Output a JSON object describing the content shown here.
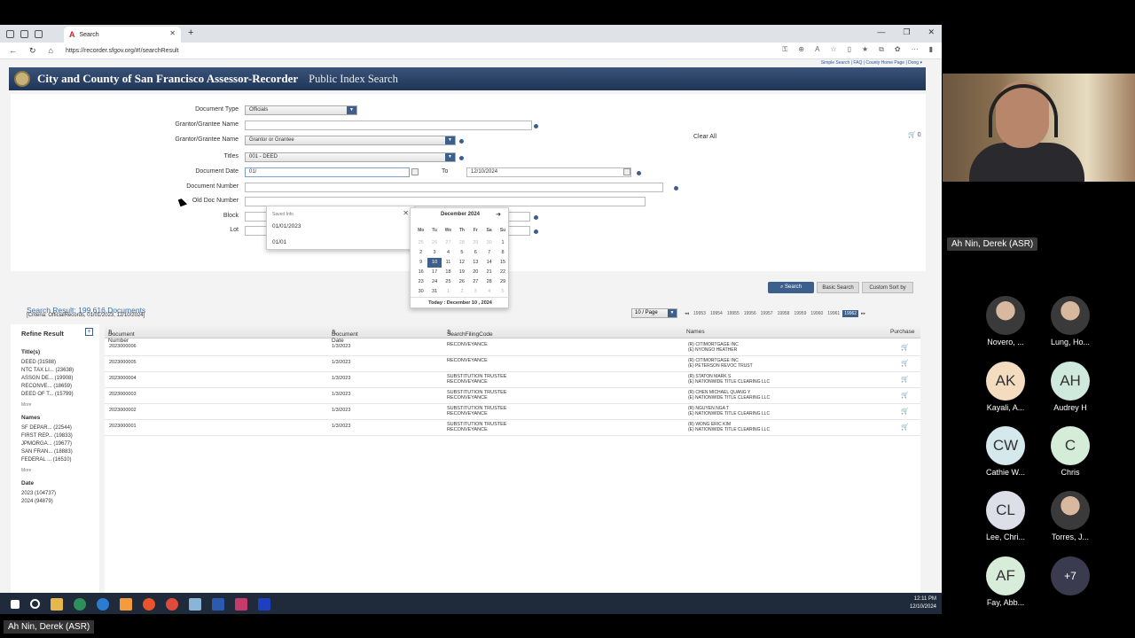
{
  "browser": {
    "tab_title": "Search",
    "url": "https://recorder.sfgov.org/#!/searchResult",
    "top_links": "Simple Search | FAQ | County Home Page | Dong ▾"
  },
  "banner": {
    "org": "City and County of San Francisco Assessor-Recorder",
    "subtitle": "Public Index Search"
  },
  "form": {
    "document_type_label": "Document Type",
    "document_type_value": "Officials",
    "grantor_name_label": "Grantor/Grantee Name",
    "grantor_name_value": "",
    "grantor_type_label": "Grantor/Grantee Name",
    "grantor_type_value": "Grantor or Grantee",
    "titles_label": "Titles",
    "titles_value": "001 - DEED",
    "doc_date_label": "Document Date",
    "doc_date_from": "01/",
    "to_label": "To",
    "doc_date_to": "12/10/2024",
    "doc_number_label": "Document Number",
    "old_doc_label": "Old Doc Number",
    "block_label": "Block",
    "lot_label": "Lot",
    "clear_all": "Clear All",
    "cart_count": "0"
  },
  "saved_info": {
    "header": "Saved Info",
    "items": [
      "01/01/2023",
      "01/01"
    ]
  },
  "calendar": {
    "month": "December 2024",
    "days_of_week": [
      "Mo",
      "Tu",
      "We",
      "Th",
      "Fr",
      "Sa",
      "Su"
    ],
    "today_text": "Today : December 10 , 2024"
  },
  "buttons": {
    "search": "Search",
    "basic_search": "Basic Search",
    "custom_sort": "Custom Sort by"
  },
  "results": {
    "title": "Search Result: 199,616 Documents",
    "criteria": "[Criteria: OfficialRecords, 01/01/2023, 12/10/2024]",
    "per_page": "10 / Page",
    "pages": [
      "19953",
      "19954",
      "19955",
      "19956",
      "19957",
      "19958",
      "19959",
      "19960",
      "19961",
      "19962"
    ],
    "columns": [
      "Document Number",
      "Document Date",
      "SearchFilingCode",
      "Names",
      "Purchase"
    ],
    "rows": [
      {
        "num": "2023000006",
        "date": "1/3/2023",
        "code": "RECONVEYANCE",
        "code2": "",
        "name1": "(R) CITIMORTGAGE INC",
        "name2": "(E) NYONGO HEATHER"
      },
      {
        "num": "2023000005",
        "date": "1/3/2023",
        "code": "RECONVEYANCE",
        "code2": "",
        "name1": "(R) CITIMORTGAGE INC",
        "name2": "(E) PETERSON REVOC TRUST"
      },
      {
        "num": "2023000004",
        "date": "1/3/2023",
        "code": "SUBSTITUTION TRUSTEE",
        "code2": "RECONVEYANCE",
        "name1": "(R) STATON MARK S",
        "name2": "(E) NATIONWIDE TITLE CLEARING LLC"
      },
      {
        "num": "2023000003",
        "date": "1/3/2023",
        "code": "SUBSTITUTION TRUSTEE",
        "code2": "RECONVEYANCE",
        "name1": "(R) CHEN MICHAEL QUANG Y",
        "name2": "(E) NATIONWIDE TITLE CLEARING LLC"
      },
      {
        "num": "2023000002",
        "date": "1/3/2023",
        "code": "SUBSTITUTION TRUSTEE",
        "code2": "RECONVEYANCE",
        "name1": "(R) NGUYEN NGA T",
        "name2": "(E) NATIONWIDE TITLE CLEARING LLC"
      },
      {
        "num": "2023000001",
        "date": "1/3/2023",
        "code": "SUBSTITUTION TRUSTEE",
        "code2": "RECONVEYANCE",
        "name1": "(R) WONG ERIC KIM",
        "name2": "(E) NATIONWIDE TITLE CLEARING LLC"
      }
    ]
  },
  "refine": {
    "title": "Refine Result",
    "titles_header": "Title(s)",
    "titles": [
      "DEED (31588)",
      "NTC TAX LI... (23638)",
      "ASSGN DE... (19908)",
      "RECONVE... (18659)",
      "DEED OF T... (15799)"
    ],
    "names_header": "Names",
    "names": [
      "SF DEPAR... (22544)",
      "FIRST REP... (19833)",
      "JPMORGA... (19677)",
      "SAN FRAN... (18883)",
      "FEDERAL ... (16510)"
    ],
    "date_header": "Date",
    "dates": [
      "2023 (104737)",
      "2024 (94879)"
    ],
    "more": "More"
  },
  "taskbar": {
    "time": "12:11 PM",
    "date": "12/10/2024"
  },
  "meeting": {
    "speaker_tag": "Ah Nin, Derek (ASR)",
    "bottom_tag": "Ah Nin, Derek (ASR)",
    "participants": [
      {
        "name": "Novero, ...",
        "initials": "",
        "color": ""
      },
      {
        "name": "Lung, Ho...",
        "initials": "",
        "color": ""
      },
      {
        "name": "Kayali, A...",
        "initials": "AK",
        "color": "#f4dcc0"
      },
      {
        "name": "Audrey H",
        "initials": "AH",
        "color": "#cfe9dd"
      },
      {
        "name": "Cathie W...",
        "initials": "CW",
        "color": "#d5e8ec"
      },
      {
        "name": "Chris",
        "initials": "C",
        "color": "#d5ecd9"
      },
      {
        "name": "Lee, Chri...",
        "initials": "CL",
        "color": "#dddfe8"
      },
      {
        "name": "Torres, J...",
        "initials": "",
        "color": ""
      },
      {
        "name": "Fay, Abb...",
        "initials": "AF",
        "color": "#d7ecd9"
      }
    ],
    "more_count": "+7"
  }
}
